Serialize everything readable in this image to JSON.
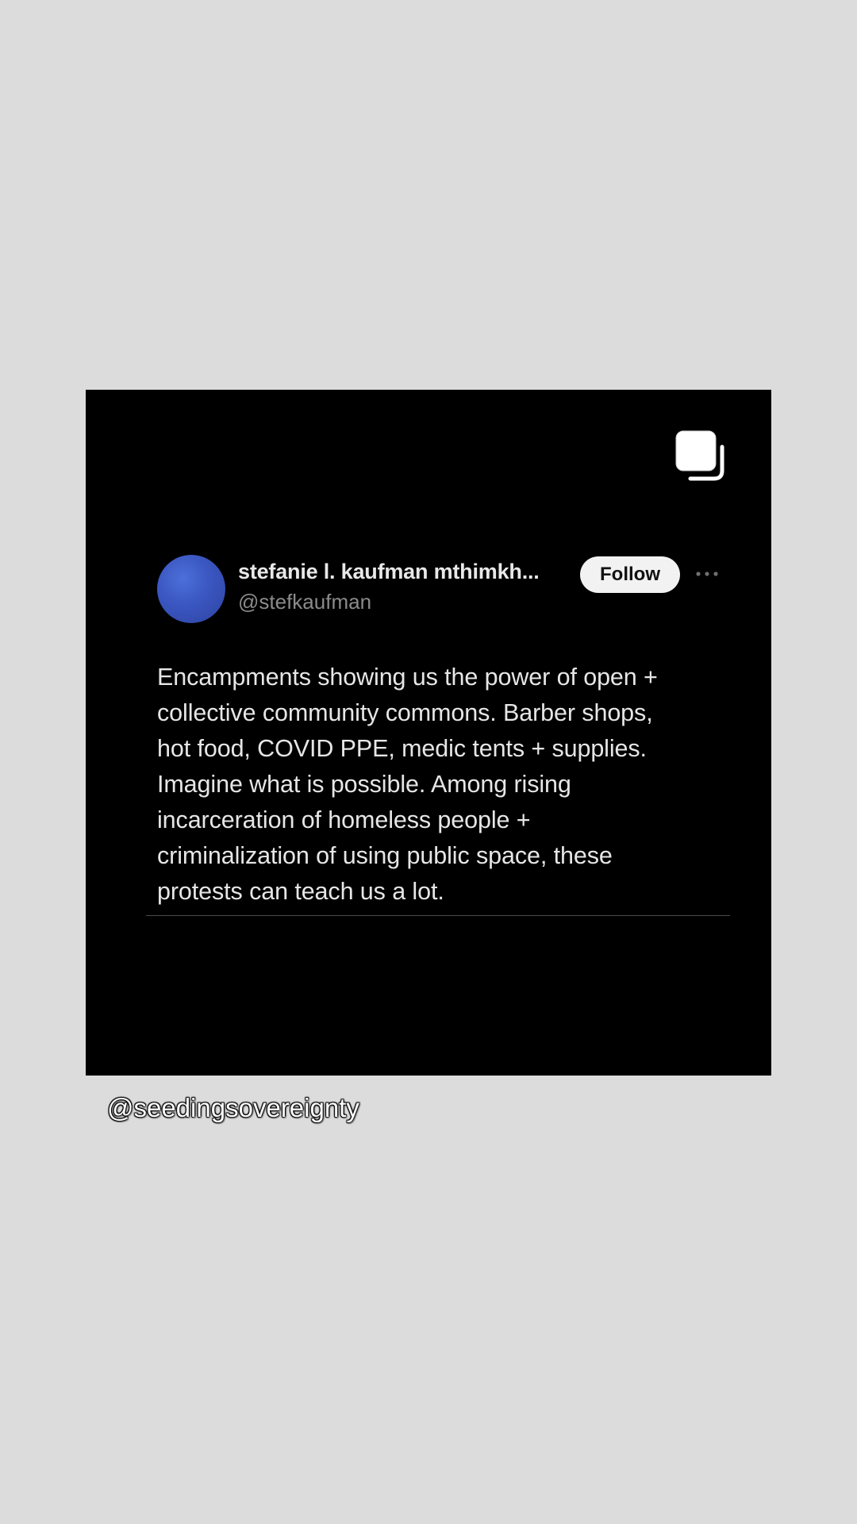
{
  "post": {
    "author": {
      "display_name": "stefanie l. kaufman mthimkh...",
      "handle": "@stefkaufman",
      "avatar_color": "#3a56c0"
    },
    "follow_label": "Follow",
    "more_icon": "more-horizontal-icon",
    "carousel_icon": "multiple-images-icon",
    "text_lines": [
      "Encampments showing us the power of open +",
      "collective community commons. Barber shops,",
      "hot food, COVID PPE, medic tents + supplies.",
      "Imagine what is possible. Among rising",
      "incarceration of homeless people +",
      "criminalization of using public space, these",
      "protests can teach us a lot."
    ]
  },
  "caption": {
    "text": "@seedingsovereignty"
  },
  "colors": {
    "page_background": "#dcdcdc",
    "card_background": "#000000",
    "follow_button": "#f2f2f2"
  }
}
